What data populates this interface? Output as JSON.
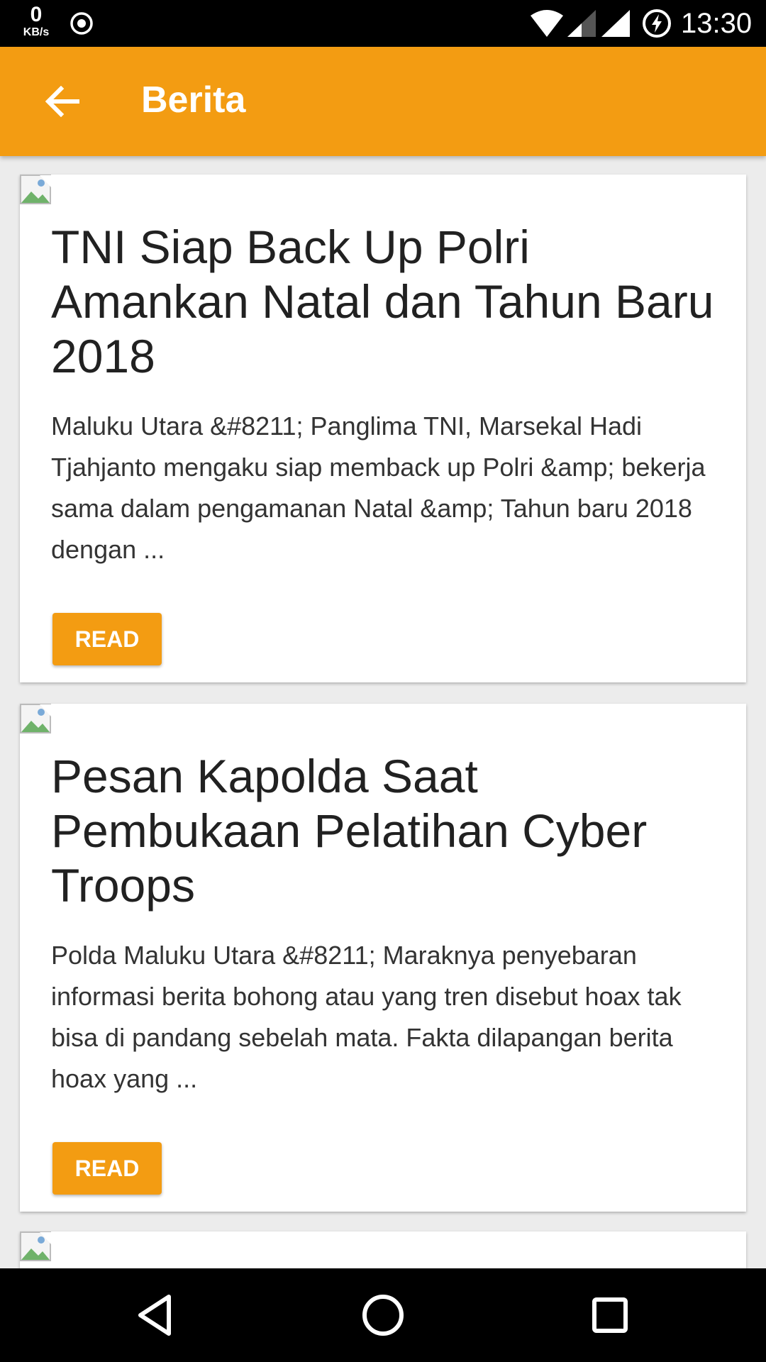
{
  "status_bar": {
    "net_speed": "0",
    "net_unit": "KB/s",
    "time": "13:30"
  },
  "app_bar": {
    "title": "Berita"
  },
  "articles": [
    {
      "title": "TNI Siap Back Up Polri Amankan Natal dan Tahun Baru 2018",
      "excerpt": "Maluku Utara &#8211; Panglima TNI, Marsekal Hadi Tjahjanto mengaku  siap memback up Polri &amp; bekerja sama dalam pengamanan Natal &amp; Tahun baru 2018 dengan ...",
      "button": "READ"
    },
    {
      "title": "Pesan Kapolda Saat Pembukaan Pelatihan Cyber Troops",
      "excerpt": "Polda Maluku Utara &#8211; Maraknya penyebaran informasi berita bohong atau yang tren disebut hoax tak bisa di pandang sebelah mata. Fakta dilapangan berita hoax yang ...",
      "button": "READ"
    }
  ],
  "colors": {
    "accent": "#f39c12",
    "background": "#ececec"
  }
}
